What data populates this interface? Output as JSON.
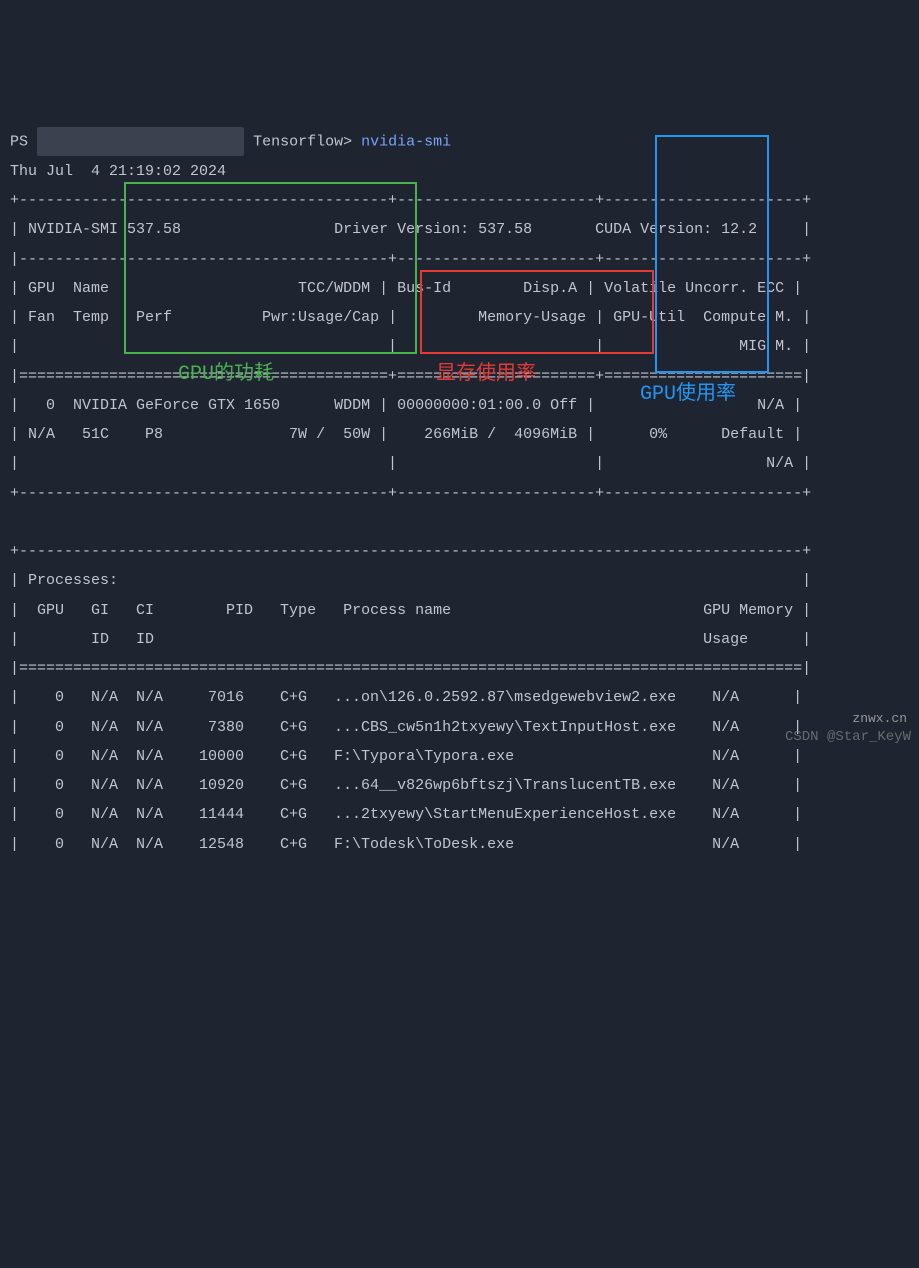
{
  "prompt": {
    "ps": "PS ",
    "redacted_path": "                       ",
    "path_suffix": "Tensorflow>",
    "command": "nvidia-smi"
  },
  "timestamp": "Thu Jul  4 21:19:02 2024",
  "header": {
    "smi_version": "NVIDIA-SMI 537.58",
    "driver_version": "Driver Version: 537.58",
    "cuda_version": "CUDA Version: 12.2"
  },
  "columns": {
    "row1_col1": "GPU  Name                     TCC/WDDM",
    "row1_col2": "Bus-Id        Disp.A",
    "row1_col3": "Volatile Uncorr. ECC",
    "row2_col1": "Fan  Temp   Perf          Pwr:Usage/Cap",
    "row2_col2": "Memory-Usage",
    "row2_col3": "GPU-Util  Compute M.",
    "row3_col3": "MIG M."
  },
  "gpu": {
    "line1_col1": "  0  NVIDIA GeForce GTX 1650      WDDM",
    "line1_col2": "00000000:01:00.0 Off",
    "line1_col3": "N/A",
    "line2_col1": "N/A   51C    P8              7W /  50W",
    "line2_col2": "266MiB /  4096MiB",
    "line2_col3_util": "0%",
    "line2_col3_mode": "Default",
    "line3_col3": "N/A"
  },
  "processes": {
    "title": "Processes:",
    "hdr1": "  GPU   GI   CI        PID   Type   Process name                            GPU Memory",
    "hdr2": "        ID   ID                                                             Usage",
    "rows": [
      {
        "gpu": "0",
        "gi": "N/A",
        "ci": "N/A",
        "pid": "7016",
        "type": "C+G",
        "name": "...on\\126.0.2592.87\\msedgewebview2.exe",
        "mem": "N/A"
      },
      {
        "gpu": "0",
        "gi": "N/A",
        "ci": "N/A",
        "pid": "7380",
        "type": "C+G",
        "name": "...CBS_cw5n1h2txyewy\\TextInputHost.exe",
        "mem": "N/A"
      },
      {
        "gpu": "0",
        "gi": "N/A",
        "ci": "N/A",
        "pid": "10000",
        "type": "C+G",
        "name": "F:\\Typora\\Typora.exe",
        "mem": "N/A"
      },
      {
        "gpu": "0",
        "gi": "N/A",
        "ci": "N/A",
        "pid": "10920",
        "type": "C+G",
        "name": "...64__v826wp6bftszj\\TranslucentTB.exe",
        "mem": "N/A"
      },
      {
        "gpu": "0",
        "gi": "N/A",
        "ci": "N/A",
        "pid": "11444",
        "type": "C+G",
        "name": "...2txyewy\\StartMenuExperienceHost.exe",
        "mem": "N/A"
      },
      {
        "gpu": "0",
        "gi": "N/A",
        "ci": "N/A",
        "pid": "12548",
        "type": "C+G",
        "name": "F:\\Todesk\\ToDesk.exe",
        "mem": "N/A"
      }
    ]
  },
  "annotations": {
    "green_label": "GPU的功耗",
    "red_label": "显存使用率",
    "blue_label": "GPU使用率"
  },
  "watermark": "CSDN @Star_KeyW",
  "watermark2": "znwx.cn"
}
